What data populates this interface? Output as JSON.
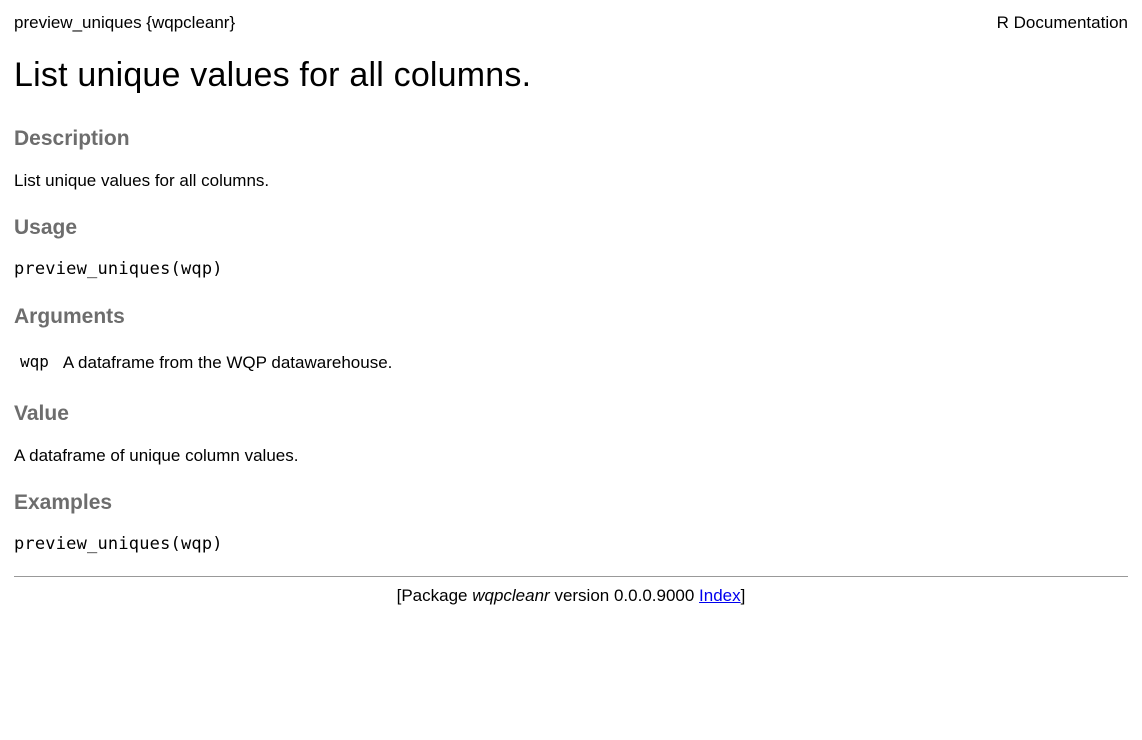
{
  "header": {
    "left": "preview_uniques {wqpcleanr}",
    "right": "R Documentation"
  },
  "title": "List unique values for all columns.",
  "sections": {
    "description": {
      "heading": "Description",
      "text": "List unique values for all columns."
    },
    "usage": {
      "heading": "Usage",
      "code": "preview_uniques(wqp)"
    },
    "arguments": {
      "heading": "Arguments",
      "items": [
        {
          "name": "wqp",
          "desc": "A dataframe from the WQP datawarehouse."
        }
      ]
    },
    "value": {
      "heading": "Value",
      "text": "A dataframe of unique column values."
    },
    "examples": {
      "heading": "Examples",
      "code": "preview_uniques(wqp)"
    }
  },
  "footer": {
    "prefix": "[Package ",
    "pkg": "wqpcleanr",
    "version_text": " version 0.0.0.9000 ",
    "link_text": "Index",
    "suffix": "]"
  }
}
